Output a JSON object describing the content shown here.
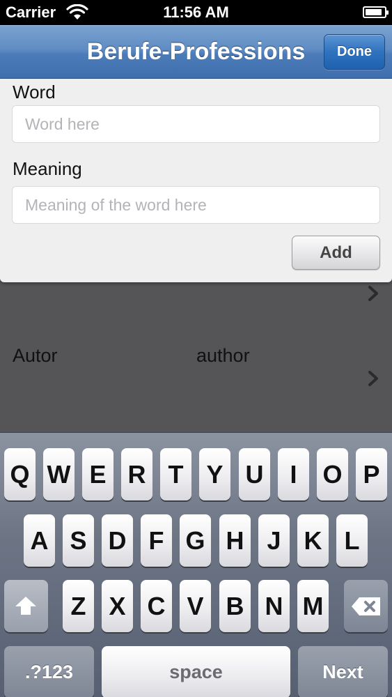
{
  "status_bar": {
    "carrier": "Carrier",
    "time": "11:56 AM",
    "battery_level": 0.9
  },
  "nav": {
    "title": "Berufe-Professions",
    "done_label": "Done"
  },
  "form": {
    "word_label": "Word",
    "word_placeholder": "Word here",
    "word_value": "",
    "meaning_label": "Meaning",
    "meaning_placeholder": "Meaning of the word here",
    "meaning_value": "",
    "add_label": "Add"
  },
  "list": {
    "items": [
      {
        "word": "",
        "meaning": ""
      },
      {
        "word": "Autor",
        "meaning": "author"
      }
    ]
  },
  "keyboard": {
    "row1": [
      "Q",
      "W",
      "E",
      "R",
      "T",
      "Y",
      "U",
      "I",
      "O",
      "P"
    ],
    "row2": [
      "A",
      "S",
      "D",
      "F",
      "G",
      "H",
      "J",
      "K",
      "L"
    ],
    "row3": [
      "Z",
      "X",
      "C",
      "V",
      "B",
      "N",
      "M"
    ],
    "numbers_label": ".?123",
    "space_label": "space",
    "return_label": "Next"
  },
  "icons": {
    "wifi": "wifi-icon",
    "battery": "battery-icon",
    "chevron": "chevron-right-icon",
    "shift": "shift-arrow-icon",
    "delete": "backspace-icon"
  }
}
